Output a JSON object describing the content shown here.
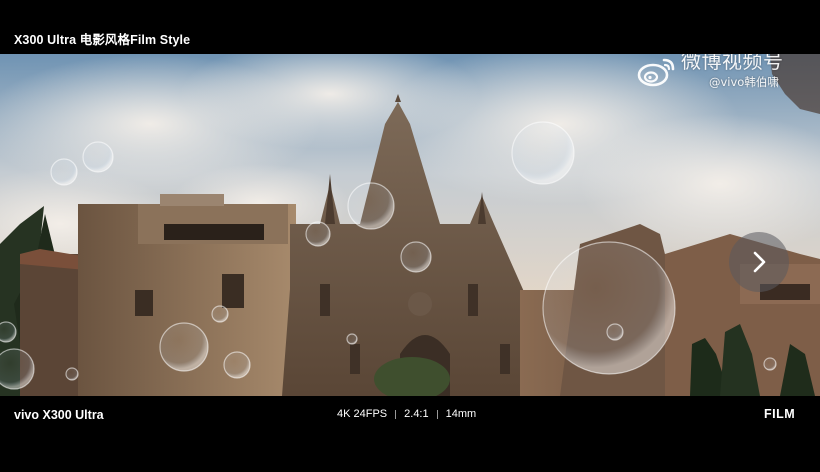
{
  "header": {
    "title": "X300 Ultra 电影风格Film Style"
  },
  "watermark": {
    "brand": "微博视频号",
    "handle": "@vivo韩伯啸",
    "icon": "weibo-logo-icon"
  },
  "controls": {
    "next_icon": "chevron-right-icon"
  },
  "footer": {
    "device": "vivo X300 Ultra",
    "specs": [
      "4K 24FPS",
      "2.4:1",
      "14mm"
    ],
    "badge": "FILM"
  },
  "colors": {
    "background": "#000000",
    "text": "#ffffff",
    "sky": "#a9b8c6",
    "stone": "#8a7258"
  }
}
